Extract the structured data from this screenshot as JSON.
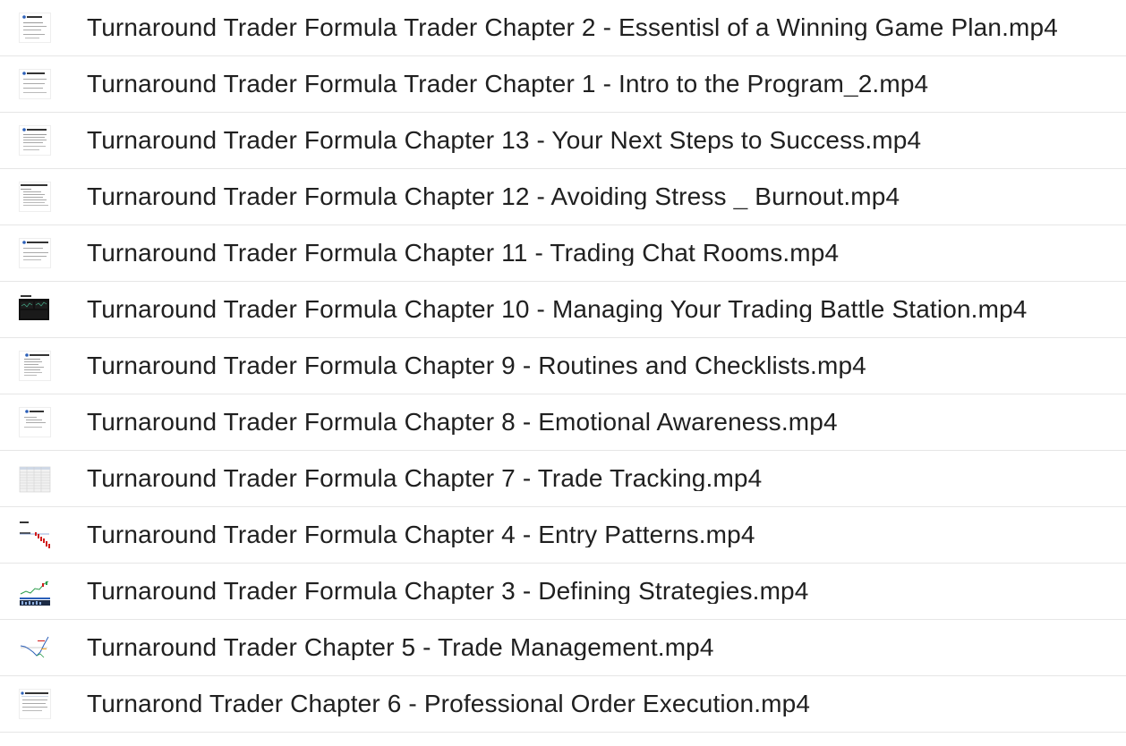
{
  "files": [
    {
      "name": "Turnaround Trader Formula Trader Chapter 2 - Essentisl of a Winning Game Plan.mp4",
      "thumbnail": "slide-doc-thumbnail-icon"
    },
    {
      "name": "Turnaround Trader Formula Trader Chapter 1 - Intro to the Program_2.mp4",
      "thumbnail": "slide-doc-thumbnail-icon"
    },
    {
      "name": "Turnaround Trader Formula Chapter 13 - Your Next Steps to Success.mp4",
      "thumbnail": "slide-doc-thumbnail-icon"
    },
    {
      "name": "Turnaround Trader Formula Chapter 12 - Avoiding Stress _ Burnout.mp4",
      "thumbnail": "slide-list-thumbnail-icon"
    },
    {
      "name": "Turnaround Trader Formula Chapter 11 - Trading Chat Rooms.mp4",
      "thumbnail": "slide-doc-thumbnail-icon"
    },
    {
      "name": "Turnaround Trader Formula Chapter 10 - Managing Your Trading Battle Station.mp4",
      "thumbnail": "dark-screen-thumbnail-icon"
    },
    {
      "name": "Turnaround Trader Formula Chapter 9 - Routines and Checklists.mp4",
      "thumbnail": "slide-doc-thumbnail-icon"
    },
    {
      "name": "Turnaround Trader Formula Chapter 8 - Emotional Awareness.mp4",
      "thumbnail": "slide-doc-thumbnail-icon"
    },
    {
      "name": "Turnaround Trader Formula Chapter 7 - Trade Tracking.mp4",
      "thumbnail": "spreadsheet-thumbnail-icon"
    },
    {
      "name": "Turnaround Trader Formula Chapter 4 - Entry Patterns.mp4",
      "thumbnail": "chart-red-thumbnail-icon"
    },
    {
      "name": "Turnaround Trader Formula Chapter 3 - Defining Strategies.mp4",
      "thumbnail": "chart-candles-thumbnail-icon"
    },
    {
      "name": "Turnaround Trader Chapter 5 - Trade Management.mp4",
      "thumbnail": "chart-line-thumbnail-icon"
    },
    {
      "name": "Turnarond Trader Chapter 6 - Professional Order Execution.mp4",
      "thumbnail": "slide-doc-thumbnail-icon"
    }
  ],
  "colors": {
    "row_border": "#e6e6e6",
    "text": "#202020",
    "thumb_accent_blue": "#2b5fb8",
    "thumb_accent_red": "#d11a1a",
    "thumb_dark": "#111111"
  }
}
